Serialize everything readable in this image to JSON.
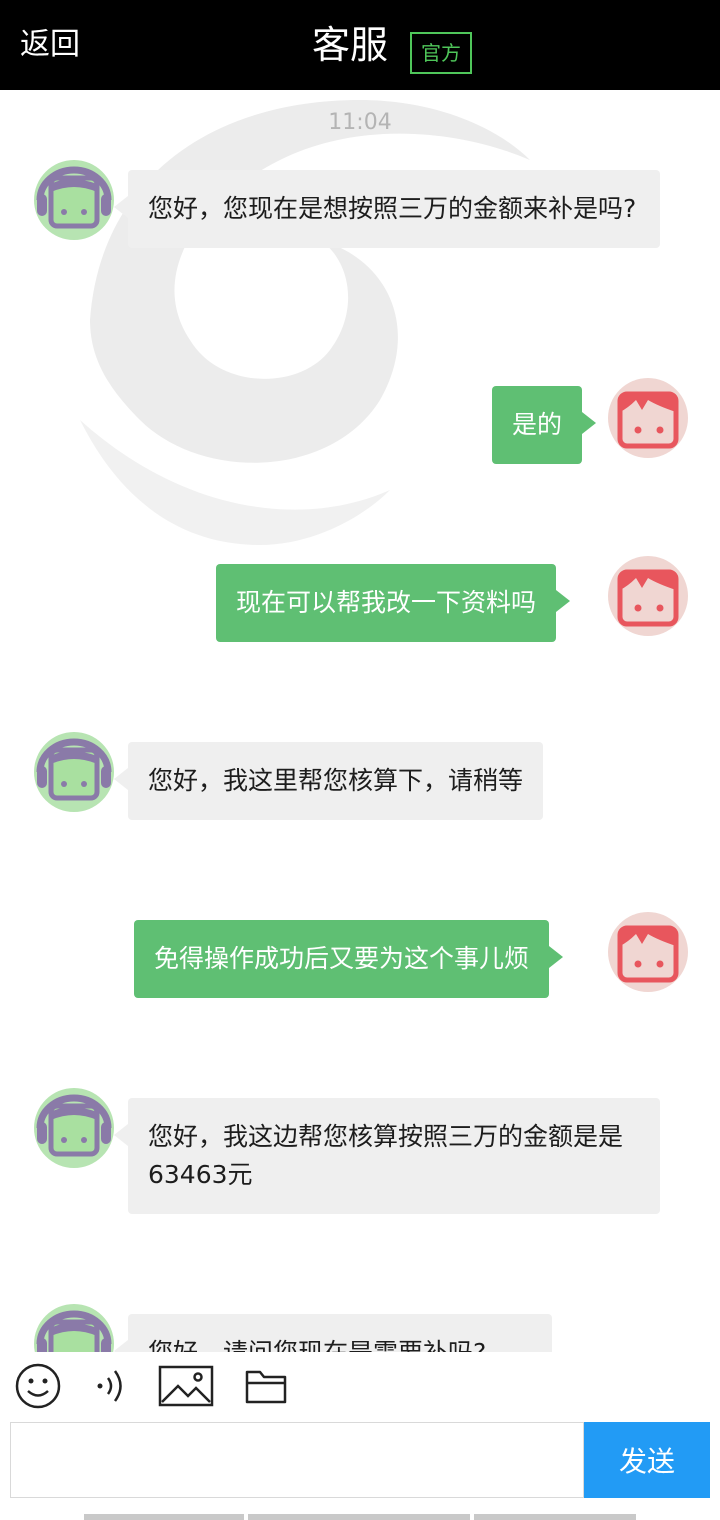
{
  "header": {
    "back_label": "返回",
    "title": "客服",
    "badge": "官方"
  },
  "chat": {
    "timestamp": "11:04",
    "messages": [
      {
        "sender": "agent",
        "text": "您好，您现在是想按照三万的金额来补是吗?"
      },
      {
        "sender": "user",
        "text": "是的"
      },
      {
        "sender": "user",
        "text": "现在可以帮我改一下资料吗"
      },
      {
        "sender": "agent",
        "text": "您好，我这里帮您核算下，请稍等"
      },
      {
        "sender": "user",
        "text": "免得操作成功后又要为这个事儿烦"
      },
      {
        "sender": "agent",
        "text": "您好，我这边帮您核算按照三万的金额是是63463元"
      },
      {
        "sender": "agent",
        "text": "您好，请问您现在是需要补吗?"
      }
    ]
  },
  "input_bar": {
    "send_label": "发送",
    "input_value": "",
    "tools": [
      "emoji-icon",
      "voice-icon",
      "image-icon",
      "folder-icon"
    ]
  },
  "colors": {
    "user_bubble": "#5fbf73",
    "agent_bubble": "#efefef",
    "send_button": "#229bf5",
    "badge": "#4fc65a"
  }
}
